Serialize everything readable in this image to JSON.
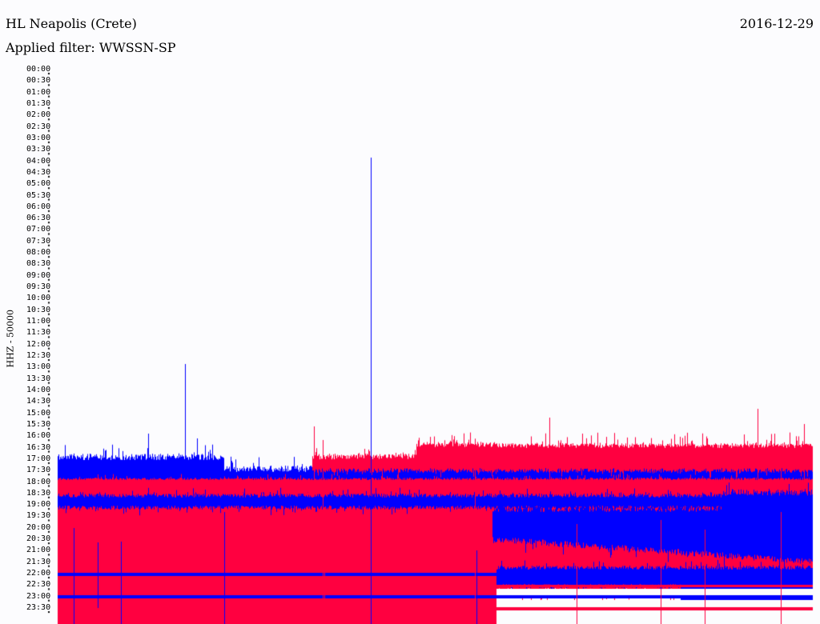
{
  "header": {
    "station": "HL Neapolis (Crete)",
    "filter": "Applied filter: WWSSN-SP",
    "date": "2016-12-29"
  },
  "chart_data": {
    "type": "line",
    "title": "HL Neapolis (Crete)",
    "subtitle": "Applied filter: WWSSN-SP",
    "ylabel": "HHZ - 50000",
    "xlabel": "",
    "ytick_labels": [
      "00:00",
      "00:30",
      "01:00",
      "01:30",
      "02:00",
      "02:30",
      "03:00",
      "03:30",
      "04:00",
      "04:30",
      "05:00",
      "05:30",
      "06:00",
      "06:30",
      "07:00",
      "07:30",
      "08:00",
      "08:30",
      "09:00",
      "09:30",
      "10:00",
      "10:30",
      "11:00",
      "11:30",
      "12:00",
      "12:30",
      "13:00",
      "13:30",
      "14:00",
      "14:30",
      "15:00",
      "15:30",
      "16:00",
      "16:30",
      "17:00",
      "17:30",
      "18:00",
      "18:30",
      "19:00",
      "19:30",
      "20:00",
      "20:30",
      "21:00",
      "21:30",
      "22:00",
      "22:30",
      "23:00",
      "23:30"
    ],
    "series_colors": [
      "#0000ff",
      "#ff0040"
    ],
    "grid": false
  }
}
